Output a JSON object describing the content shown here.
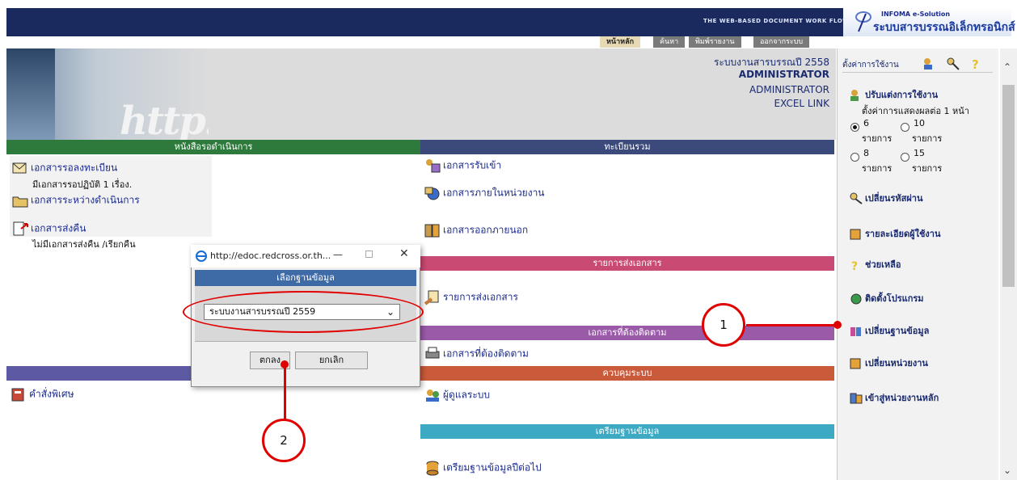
{
  "banner": {
    "tagline": "THE WEB-BASED DOCUMENT WORK FLOW",
    "brand_small": "INFOMA e-Solution",
    "brand_big": "ระบบสารบรรณอิเล็กทรอนิกส์"
  },
  "nav": [
    "หน้าหลัก",
    "ค้นหา",
    "พิมพ์รายงาน",
    "ออกจากระบบ"
  ],
  "header": {
    "hero_text": "http:",
    "system_title": "ระบบงานสารบรรณปี 2558",
    "user_bold": "ADMINISTRATOR",
    "user_line2": "ADMINISTRATOR",
    "user_line3": "EXCEL LINK"
  },
  "sections": {
    "pending": {
      "title": "หนังสือรอดำเนินการ",
      "item1": "เอกสารรอลงทะเบียน",
      "item1_sub": "มีเอกสารรอปฏิบัติ 1 เรื่อง.",
      "item2": "เอกสารระหว่างดำเนินการ",
      "item3": "เอกสารส่งคืน",
      "item3_sub": "ไม่มีเอกสารส่งคืน /เรียกคืน"
    },
    "register": {
      "title": "ทะเบียนรวม",
      "item1": "เอกสารรับเข้า",
      "item2": "เอกสารภายในหน่วยงาน",
      "item3": "เอกสารออกภายนอก"
    },
    "send_list": {
      "title": "รายการส่งเอกสาร",
      "item1": "รายการส่งเอกสาร"
    },
    "follow": {
      "title": "เอกสารที่ต้องติดตาม",
      "item1": "เอกสารที่ต้องติดตาม"
    },
    "special": {
      "item1": "คำสั่งพิเศษ"
    },
    "control": {
      "title": "ควบคุมระบบ",
      "item1": "ผู้ดูแลระบบ"
    },
    "prepare": {
      "title": "เตรียมฐานข้อมูล",
      "item1": "เตรียมฐานข้อมูลปีต่อไป"
    }
  },
  "right_panel": {
    "header_label": "ตั้งค่าการใช้งาน",
    "customize": "ปรับแต่งการใช้งาน",
    "display_setting": "ตั้งค่าการแสดงผลต่อ 1 หน้า",
    "options": [
      {
        "value": "6",
        "unit": "รายการ",
        "checked": true
      },
      {
        "value": "10",
        "unit": "รายการ",
        "checked": false
      },
      {
        "value": "8",
        "unit": "รายการ",
        "checked": false
      },
      {
        "value": "15",
        "unit": "รายการ",
        "checked": false
      }
    ],
    "links": [
      "เปลี่ยนรหัสผ่าน",
      "รายละเอียดผู้ใช้งาน",
      "ช่วยเหลือ",
      "ติดตั้งโปรแกรม",
      "เปลี่ยนฐานข้อมูล",
      "เปลี่ยนหน่วยงาน",
      "เข้าสู่หน่วยงานหลัก"
    ]
  },
  "dialog": {
    "window_title": "http://edoc.redcross.or.th...",
    "header": "เลือกฐานข้อมูล",
    "selected": "ระบบงานสารบรรณปี 2559",
    "ok": "ตกลง",
    "cancel": "ยกเลิก"
  },
  "callouts": [
    "1",
    "2"
  ]
}
